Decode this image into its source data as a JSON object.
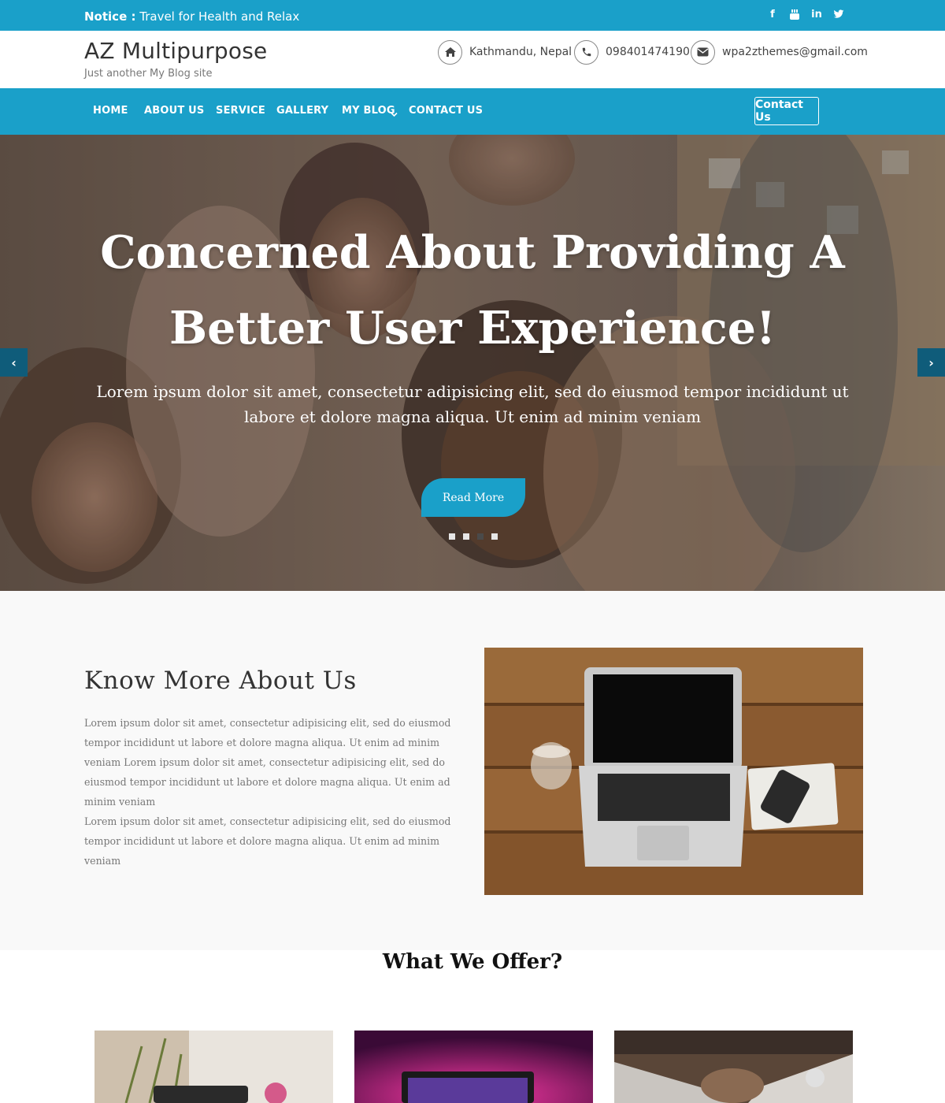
{
  "topbar": {
    "notice_label": "Notice :",
    "notice_text": "Travel for Health and Relax",
    "social": [
      {
        "icon": "facebook-icon",
        "glyph": "f"
      },
      {
        "icon": "youtube-icon",
        "glyph": "▶"
      },
      {
        "icon": "linkedin-icon",
        "glyph": "in"
      },
      {
        "icon": "twitter-icon",
        "glyph": "t"
      }
    ]
  },
  "header": {
    "site_title": "AZ Multipurpose",
    "tagline": "Just another My Blog site",
    "address": "Kathmandu, Nepal",
    "phone": "098401474190",
    "email": "wpa2zthemes@gmail.com"
  },
  "nav": {
    "items": [
      "HOME",
      "ABOUT US",
      "SERVICE",
      "GALLERY",
      "MY BLOG",
      "CONTACT US"
    ],
    "contact_button": "Contact Us"
  },
  "hero": {
    "title_line1": "Concerned About Providing A",
    "title_line2": "Better User Experience!",
    "text": "Lorem ipsum dolor sit amet, consectetur adipisicing elit, sed do eiusmod tempor incididunt ut labore et dolore magna aliqua. Ut enim ad minim veniam",
    "button": "Read More",
    "slide_count": 4,
    "active_slide": 3,
    "prev_arrow": "‹",
    "next_arrow": "›"
  },
  "about": {
    "title": "Know More About Us",
    "paragraph1": "Lorem ipsum dolor sit amet, consectetur adipisicing elit, sed do eiusmod tempor incididunt ut labore et dolore magna aliqua. Ut enim ad minim veniam Lorem ipsum dolor sit amet, consectetur adipisicing elit, sed do eiusmod tempor incididunt ut labore et dolore magna aliqua. Ut enim ad minim veniam",
    "paragraph2": "Lorem ipsum dolor sit amet, consectetur adipisicing elit, sed do eiusmod tempor incididunt ut labore et dolore magna aliqua. Ut enim ad minim veniam"
  },
  "offer": {
    "title": "What We Offer?"
  },
  "colors": {
    "accent": "#1aa0c9",
    "arrow_bg": "#0f5c7a"
  }
}
